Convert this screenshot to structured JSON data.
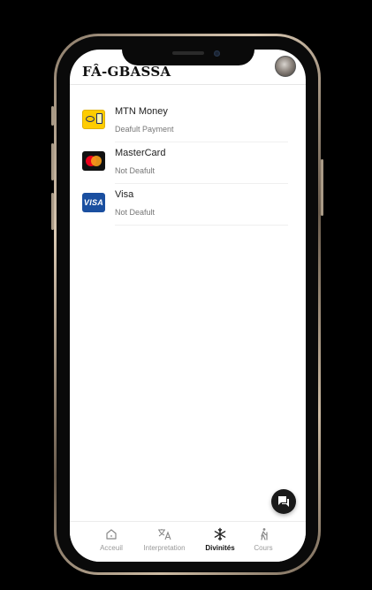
{
  "app": {
    "title": "FÂ-GBASSA"
  },
  "payments": [
    {
      "name": "MTN Money",
      "status": "Deafult Payment",
      "logo": "mtn-logo"
    },
    {
      "name": "MasterCard",
      "status": "Not Deafult",
      "logo": "mastercard-logo"
    },
    {
      "name": "Visa",
      "status": "Not Deafult",
      "logo": "visa-logo",
      "logo_text": "VISA"
    }
  ],
  "tabs": [
    {
      "label": "Acceuil",
      "icon": "home-icon",
      "active": false
    },
    {
      "label": "Interpretation",
      "icon": "translate-icon",
      "active": false
    },
    {
      "label": "Divinités",
      "icon": "snowflake-icon",
      "active": true
    },
    {
      "label": "Cours",
      "icon": "hiking-icon",
      "active": false
    }
  ],
  "fab": {
    "icon": "chat-icon"
  },
  "colors": {
    "accent": "#111111",
    "inactive": "#999999",
    "background": "#000000"
  }
}
